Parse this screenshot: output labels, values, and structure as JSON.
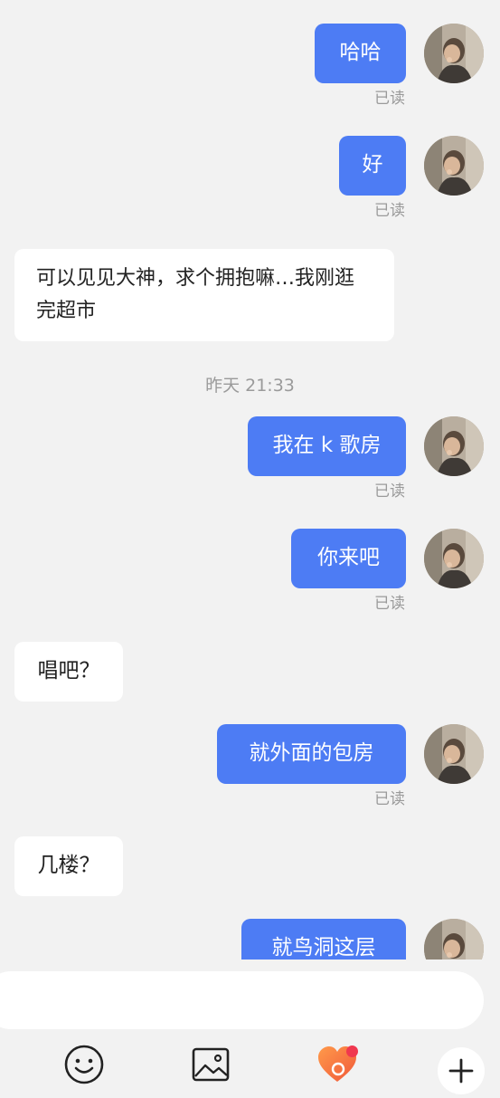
{
  "chat": {
    "read_label": "已读",
    "timestamp": "昨天 21:33",
    "messages": [
      {
        "text": "哈哈"
      },
      {
        "text": "好"
      },
      {
        "text": "可以见见大神，求个拥抱嘛…我刚逛完超市"
      },
      {
        "text": "我在 k 歌房"
      },
      {
        "text": "你来吧"
      },
      {
        "text": "唱吧？"
      },
      {
        "text": "就外面的包房"
      },
      {
        "text": "几楼？"
      },
      {
        "text": "就鸟洞这层"
      }
    ]
  },
  "input": {
    "placeholder": ""
  },
  "toolbar": {
    "icons": [
      "emoji-icon",
      "image-icon",
      "heart-gift-icon",
      "plus-icon"
    ],
    "accent": "#4d7cf4",
    "badge_color": "#f0384f"
  }
}
